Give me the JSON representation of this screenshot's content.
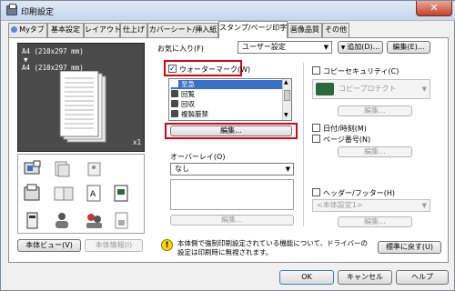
{
  "window": {
    "title": "印刷設定",
    "close": "✕"
  },
  "tabs": [
    {
      "label": "Myタブ"
    },
    {
      "label": "基本設定"
    },
    {
      "label": "レイアウト"
    },
    {
      "label": "仕上げ"
    },
    {
      "label": "カバーシート/挿入紙"
    },
    {
      "label": "スタンプ/ページ印字"
    },
    {
      "label": "画像品質"
    },
    {
      "label": "その他"
    }
  ],
  "preview": {
    "line1": "A4 (210x297 mm)",
    "arrow": "▼",
    "line2": "A4 (210x297 mm)",
    "copies": "x1"
  },
  "left_buttons": {
    "machine_view": "本体ビュー(V)",
    "machine_info": "本体情報(I)"
  },
  "favorites": {
    "label": "お気に入り(F)",
    "value": "ユーザー設定",
    "add_button": "追加(D)...",
    "edit_button": "編集(E)..."
  },
  "watermark": {
    "label": "ウォーターマーク(W)",
    "checked": "✓",
    "items": [
      "至急",
      "回覧",
      "回収",
      "複製厳禁"
    ],
    "edit_button": "編集..."
  },
  "overlay": {
    "label": "オーバーレイ(O)",
    "value": "なし",
    "edit_button": "編集..."
  },
  "copy_security": {
    "label": "コピーセキュリティ(C)",
    "value": "コピープロテクト",
    "edit_button": "編集..."
  },
  "date_time": {
    "label": "日付/時刻(M)"
  },
  "page_number": {
    "label": "ページ番号(N)",
    "edit_button": "編集..."
  },
  "header_footer": {
    "label": "ヘッダー/フッター(H)",
    "value": "<本体設定1>",
    "edit_button": "編集..."
  },
  "info_text": "本体側で強制印刷設定されている機能について、ドライバーの設定は印刷時に無視されます。",
  "buttons": {
    "defaults": "標準に戻す(U)",
    "ok": "OK",
    "cancel": "キャンセル",
    "help": "ヘルプ"
  }
}
